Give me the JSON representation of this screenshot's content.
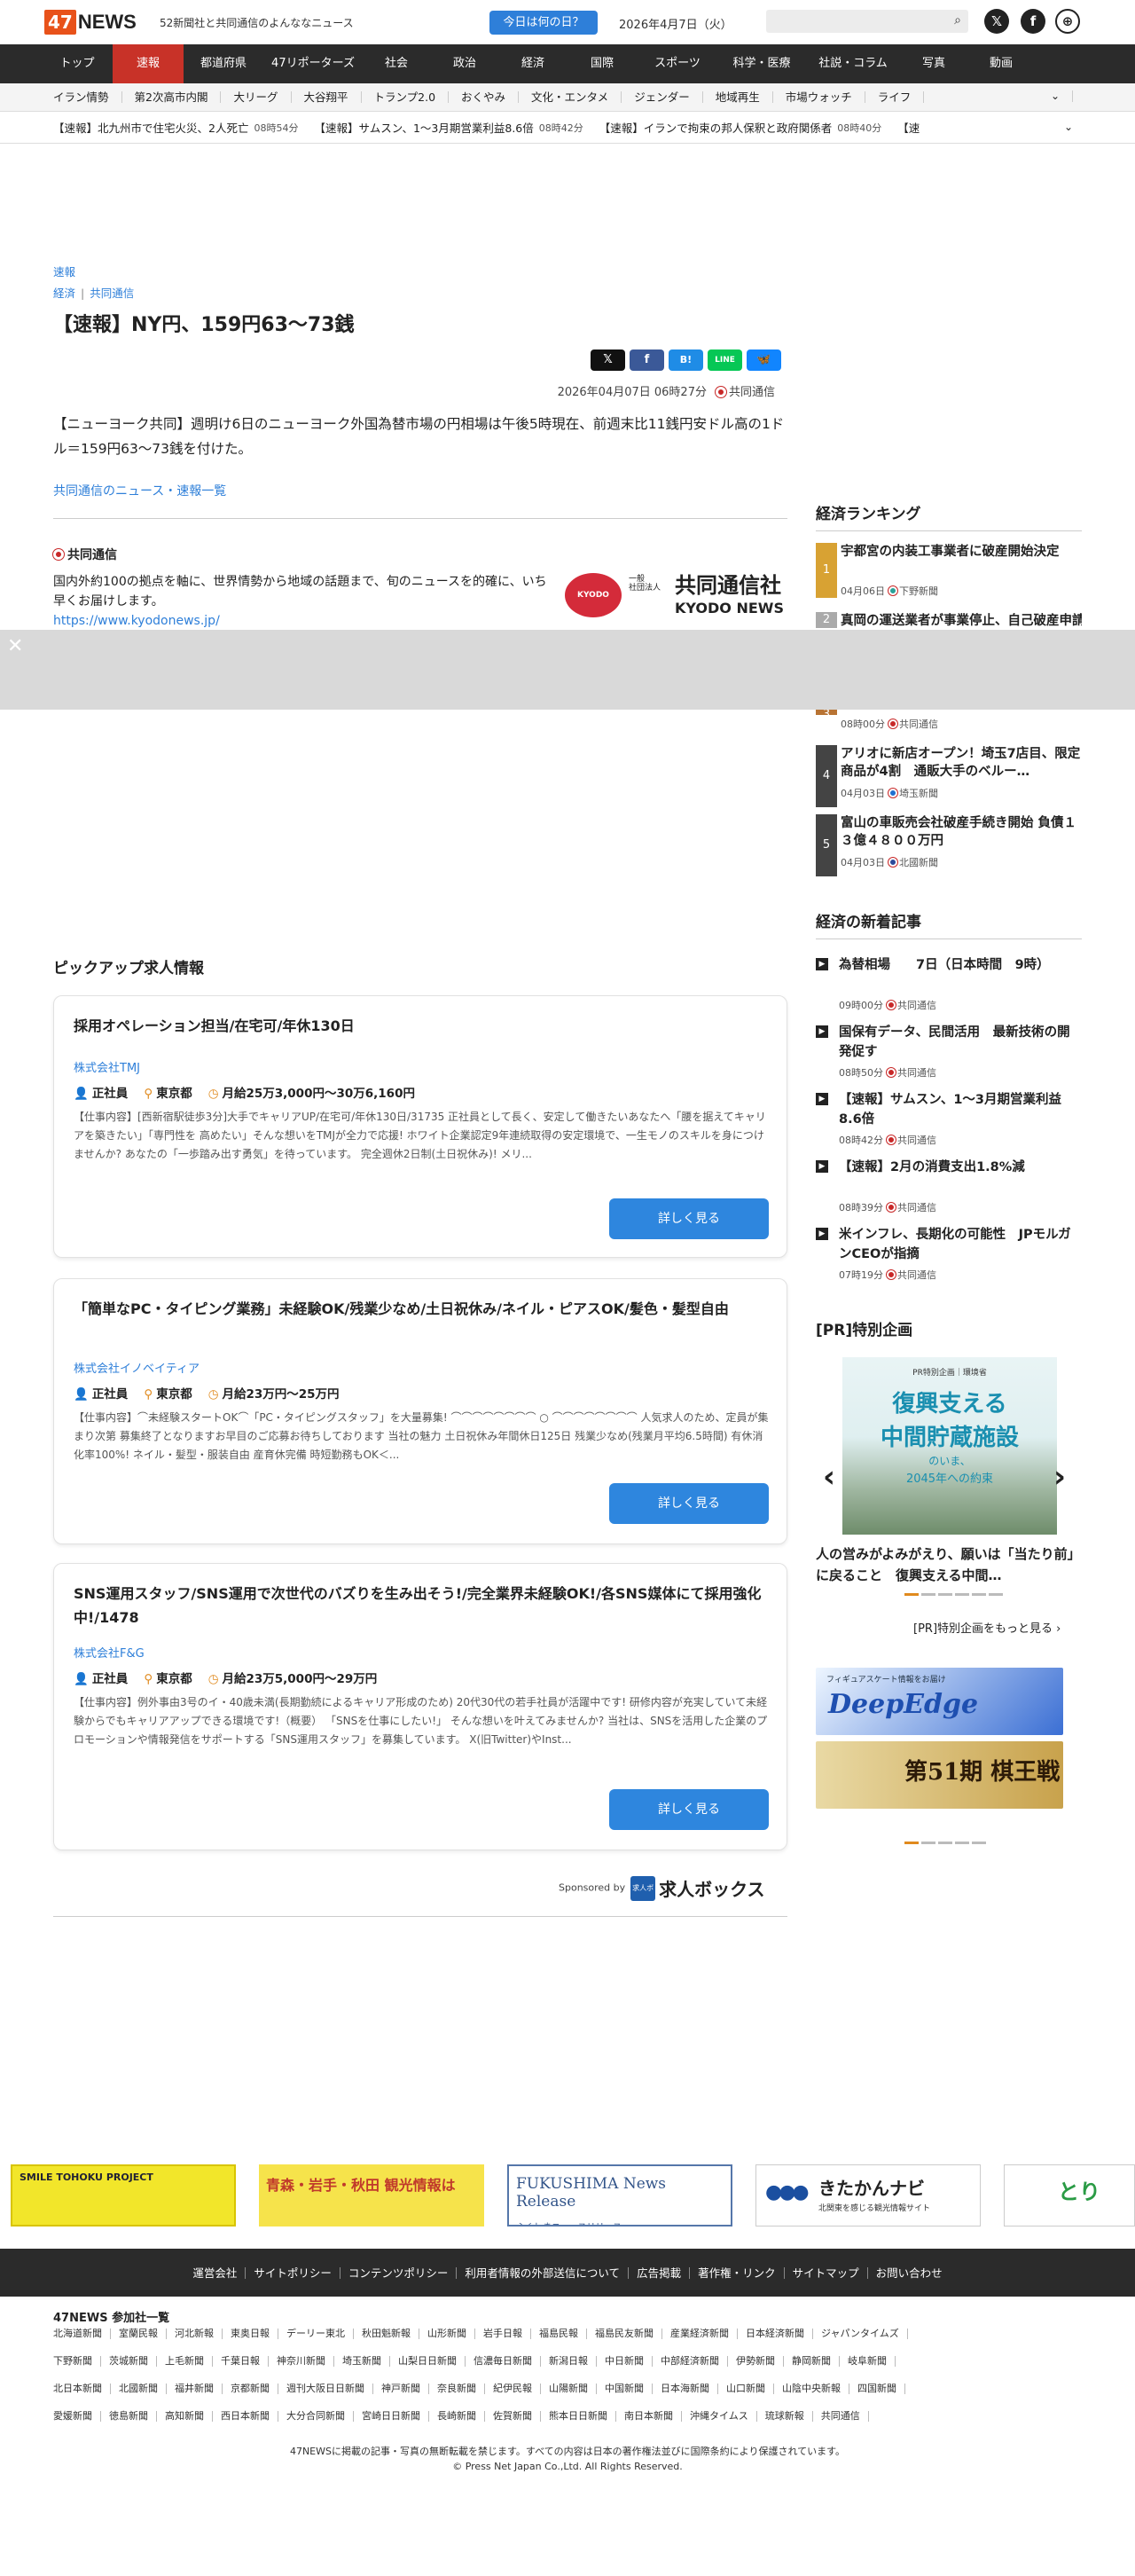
{
  "header": {
    "logo_badge": "47",
    "logo_word": "NEWS",
    "tagline": "52新聞社と共同通信のよんななニュース",
    "day_button": "今日は何の日？",
    "date": "2026年4月7日（火）",
    "search_placeholder": ""
  },
  "nav": [
    "トップ",
    "速報",
    "都道府県",
    "47リポーターズ",
    "社会",
    "政治",
    "経済",
    "国際",
    "スポーツ",
    "科学・医療",
    "社説・コラム",
    "写真",
    "動画"
  ],
  "subnav": [
    "イラン情勢",
    "第2次高市内閣",
    "大リーグ",
    "大谷翔平",
    "トランプ2.0",
    "おくやみ",
    "文化・エンタメ",
    "ジェンダー",
    "地域再生",
    "市場ウォッチ",
    "ライフ"
  ],
  "ticker": [
    {
      "text": "【速報】北九州市で住宅火災、2人死亡",
      "time": "08時54分"
    },
    {
      "text": "【速報】サムスン、1～3月期営業利益8.6倍",
      "time": "08時42分"
    },
    {
      "text": "【速報】イランで拘束の邦人保釈と政府関係者",
      "time": "08時40分"
    },
    {
      "text": "【速",
      "time": ""
    }
  ],
  "article": {
    "breadcrumb_top": "速報",
    "breadcrumb_cat": "経済",
    "breadcrumb_src": "共同通信",
    "title": "【速報】NY円、159円63～73銭",
    "share": [
      "𝕏",
      "f",
      "B!",
      "LINE",
      "🦋"
    ],
    "datetime": "2026年04月07日 06時27分",
    "source": "共同通信",
    "body": "【ニューヨーク共同】週明け6日のニューヨーク外国為替市場の円相場は午後5時現在、前週末比11銭円安ドル高の1ドル＝159円63～73銭を付けた。",
    "list_link": "共同通信のニュース・速報一覧"
  },
  "kyodo": {
    "name": "共同通信",
    "desc": "国内外約100の拠点を軸に、世界情勢から地域の話題まで、旬のニュースを的確に、いち早くお届けします。",
    "url": "https://www.kyodonews.jp/",
    "logo_circle": "KYODO",
    "logo_small": "一般\n社団法人",
    "logo_big": "共同通信社",
    "logo_en": "KYODO NEWS"
  },
  "overlay": {
    "close": "✕"
  },
  "pickup": {
    "heading": "ピックアップ求人情報",
    "jobs": [
      {
        "title": "採用オペレーション担当/在宅可/年休130日",
        "company": "株式会社TMJ",
        "type": "正社員",
        "place": "東京都",
        "salary": "月給25万3,000円〜30万6,160円",
        "desc": "【仕事内容】[西新宿駅徒歩3分]大手でキャリアUP/在宅可/年休130日/31735 正社員として長く、安定して働きたいあなたへ「腰を据えてキャリアを築きたい」「専門性を 高めたい」そんな想いをTMJが全力で応援! ホワイト企業認定9年連続取得の安定環境で、一生モノのスキルを身につけませんか? あなたの「一歩踏み出す勇気」を待っています。 完全週休2日制(土日祝休み)! メリ...",
        "button": "詳しく見る"
      },
      {
        "title": "「簡単なPC・タイピング業務」未経験OK/残業少なめ/土日祝休み/ネイル・ピアスOK/髪色・髪型自由",
        "company": "株式会社イノベイティア",
        "type": "正社員",
        "place": "東京都",
        "salary": "月給23万円〜25万円",
        "desc": "【仕事内容】⌒未経験スタートOK⌒「PC・タイピングスタッフ」を大量募集! ⌒⌒⌒⌒⌒⌒⌒⌒ ○ ⌒⌒⌒⌒⌒⌒⌒⌒ 人気求人のため、定員が集まり次第 募集終了となりますお早目のご応募お待ちしております 当社の魅力 土日祝休み年間休日125日 残業少なめ(残業月平均6.5時間) 有休消化率100%! ネイル・髪型・服装自由 産育休完備 時短勤務もOK＜...",
        "button": "詳しく見る"
      },
      {
        "title": "SNS運用スタッフ/SNS運用で次世代のバズりを生み出そう!/完全業界未経験OK!/各SNS媒体にて採用強化中!/1478",
        "company": "株式会社F&G",
        "type": "正社員",
        "place": "東京都",
        "salary": "月給23万5,000円〜29万円",
        "desc": "【仕事内容】例外事由3号のイ・40歳未満(長期勤続によるキャリア形成のため) 20代30代の若手社員が活躍中です! 研修内容が充実していて未経験からでもキャリアアップできる環境です!（概要） 「SNSを仕事にしたい!」 そんな想いを叶えてみませんか? 当社は、SNSを活用した企業のプロモーションや情報発信をサポートする「SNS運用スタッフ」を募集しています。 X(旧Twitter)やInst...",
        "button": "詳しく見る"
      }
    ],
    "sponsor_label": "Sponsored by",
    "sponsor_box": "求人ボックス",
    "sponsor_name": "求人ボックス"
  },
  "ranking": {
    "heading": "経済ランキング",
    "items": [
      {
        "num": "1",
        "title": "宇都宮の内装工事業者に破産開始決定",
        "meta": "04月06日",
        "src": "下野新聞"
      },
      {
        "num": "2",
        "title": "真岡の運送業者が事業停止、自己破産申請へ",
        "meta": "",
        "src": ""
      },
      {
        "num": "3",
        "title": "",
        "meta": "08時00分",
        "src": "共同通信"
      },
      {
        "num": "4",
        "title": "アリオに新店オープン！埼玉7店目、限定商品が4割　通販大手のベルー…",
        "meta": "04月03日",
        "src": "埼玉新聞"
      },
      {
        "num": "5",
        "title": "富山の車販売会社破産手続き開始 負債１３億４８００万円",
        "meta": "04月03日",
        "src": "北國新聞"
      }
    ]
  },
  "newest": {
    "heading": "経済の新着記事",
    "items": [
      {
        "title": "為替相場　　7日（日本時間　9時）",
        "meta": "09時00分",
        "src": "共同通信"
      },
      {
        "title": "国保有データ、民間活用　最新技術の開発促す",
        "meta": "08時50分",
        "src": "共同通信"
      },
      {
        "title": "【速報】サムスン、1～3月期営業利益8.6倍",
        "meta": "08時42分",
        "src": "共同通信"
      },
      {
        "title": "【速報】2月の消費支出1.8%減",
        "meta": "08時39分",
        "src": "共同通信"
      },
      {
        "title": "米インフレ、長期化の可能性　JPモルガンCEOが指摘",
        "meta": "07時19分",
        "src": "共同通信"
      }
    ]
  },
  "pr": {
    "heading": "[PR]特別企画",
    "img_l1": "PR特別企画｜環境省",
    "img_l2": "復興支える",
    "img_l3": "中間貯蔵施設",
    "img_l4": "のいま、",
    "img_l5": "2045年への約束",
    "caption": "人の営みがよみがえり、願いは「当たり前」に戻ること　復興支える中間…",
    "more": "[PR]特別企画をもっと見る ›",
    "banner1": "DeepEdge",
    "banner1_sub": "フィギュアスケート情報をお届け",
    "banner2": "第51期 棋王戦"
  },
  "footer_banners": [
    "SMILE TOHOKU PROJECT",
    "青森・岩手・秋田 観光情報は",
    "FUKUSHIMA News Release",
    "きたかんナビ",
    "とり"
  ],
  "footer_banner_subs": [
    "",
    "",
    "ふくしまニュースリリース",
    "北関東を感じる観光情報サイト",
    ""
  ],
  "footer_links": [
    "運営会社",
    "サイトポリシー",
    "コンテンツポリシー",
    "利用者情報の外部送信について",
    "広告掲載",
    "著作権・リンク",
    "サイトマップ",
    "お問い合わせ"
  ],
  "members_heading": "47NEWS 参加社一覧",
  "members": [
    "北海道新聞",
    "室蘭民報",
    "河北新報",
    "東奥日報",
    "デーリー東北",
    "秋田魁新報",
    "山形新聞",
    "岩手日報",
    "福島民報",
    "福島民友新聞",
    "産業経済新聞",
    "日本経済新聞",
    "ジャパンタイムズ",
    "下野新聞",
    "茨城新聞",
    "上毛新聞",
    "千葉日報",
    "神奈川新聞",
    "埼玉新聞",
    "山梨日日新聞",
    "信濃毎日新聞",
    "新潟日報",
    "中日新聞",
    "中部経済新聞",
    "伊勢新聞",
    "静岡新聞",
    "岐阜新聞",
    "北日本新聞",
    "北國新聞",
    "福井新聞",
    "京都新聞",
    "週刊大阪日日新聞",
    "神戸新聞",
    "奈良新聞",
    "紀伊民報",
    "山陽新聞",
    "中国新聞",
    "日本海新聞",
    "山口新聞",
    "山陰中央新報",
    "四国新聞",
    "愛媛新聞",
    "徳島新聞",
    "高知新聞",
    "西日本新聞",
    "大分合同新聞",
    "宮崎日日新聞",
    "長崎新聞",
    "佐賀新聞",
    "熊本日日新聞",
    "南日本新聞",
    "沖縄タイムス",
    "琉球新報",
    "共同通信"
  ],
  "copyright1": "47NEWSに掲載の記事・写真の無断転載を禁じます。すべての内容は日本の著作権法並びに国際条約により保護されています。",
  "copyright2": "© Press Net Japan Co.,Ltd. All Rights Reserved."
}
